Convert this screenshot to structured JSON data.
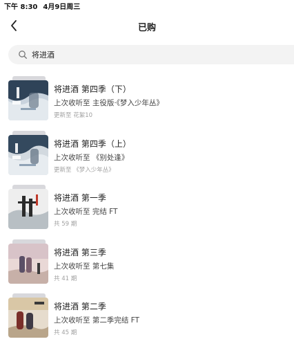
{
  "status_bar": {
    "time": "下午 8:30",
    "date": "4月9日周三"
  },
  "nav": {
    "back_icon": "chevron-left-icon",
    "title": "已购"
  },
  "search": {
    "icon": "search-icon",
    "value": "将进酒"
  },
  "items": [
    {
      "title": "将进酒 第四季（下）",
      "progress": "上次收听至 主役版·《梦入少年丛》",
      "meta": "更新至 花絮10"
    },
    {
      "title": "将进酒 第四季（上）",
      "progress": "上次收听至 《别处逢》",
      "meta": "更新至 《梦入少年丛》"
    },
    {
      "title": "将进酒 第一季",
      "progress": "上次收听至 完结 FT",
      "meta": "共 59 期"
    },
    {
      "title": "将进酒 第三季",
      "progress": "上次收听至 第七集",
      "meta": "共 41 期"
    },
    {
      "title": "将进酒 第二季",
      "progress": "上次收听至 第二季完结 FT",
      "meta": "共 45 期"
    }
  ]
}
